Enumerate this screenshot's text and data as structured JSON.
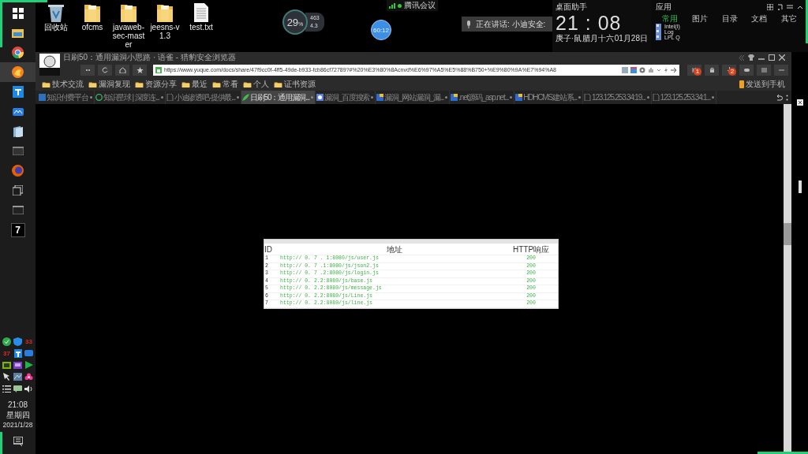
{
  "taskbar": {
    "tile_label": "7",
    "tray_counts": [
      "33",
      "37"
    ],
    "clock": {
      "time": "21:08",
      "weekday": "星期四",
      "date": "2021/1/28"
    }
  },
  "desktop_icons": [
    {
      "label": "回收站",
      "kind": "bin"
    },
    {
      "label": "ofcms",
      "kind": "folder"
    },
    {
      "label": "javaweb-sec-master",
      "kind": "folder"
    },
    {
      "label": "jeesns-v1.3",
      "kind": "folder"
    },
    {
      "label": "test.txt",
      "kind": "file"
    }
  ],
  "net_meter": {
    "percent": "29",
    "unit": "%",
    "upload": "463",
    "download": "4.3"
  },
  "meeting": {
    "title": "腾讯会议",
    "timer": "60:12",
    "speaking": "正在讲话: 小迪安全:"
  },
  "clock_widget": {
    "title": "桌面助手",
    "time": "21 : 08",
    "lunar_year": "庚子·鼠",
    "lunar_day": "腊月十六",
    "date": "01月28日"
  },
  "apps_panel": {
    "title": "应用",
    "tabs": [
      {
        "label": "常用",
        "selected": true
      },
      {
        "label": "图片",
        "selected": false
      },
      {
        "label": "目录",
        "selected": false
      },
      {
        "label": "文档",
        "selected": false
      },
      {
        "label": "其它",
        "selected": false
      }
    ],
    "items": [
      "Intel(I)",
      "Log",
      "LPL Q"
    ]
  },
  "browser": {
    "title": "日刷50：通用漏洞小思路 · 语雀 - 猎豹安全浏览器",
    "url": "https://www.yuque.com/docs/share/47f9cc0f-4ff5-49de-b933-fcb86cf72789?#%20%E3%80%8Acnvd%E6%97%A5%E5%88%B750+%E9%80%9A%E7%94%A8",
    "badges": [
      "1",
      "2"
    ],
    "bookmarks": [
      "技术交流",
      "漏洞复现",
      "资源分享",
      "最近",
      "常看",
      "个人",
      "证书资源"
    ],
    "send_to_phone": "发送到手机",
    "tabs": [
      {
        "label": "知识付费平台",
        "selected": false
      },
      {
        "label": "知识星球 | 深度连...",
        "selected": false
      },
      {
        "label": "小迪渗透吧-提供最...",
        "selected": false
      },
      {
        "label": "日刷50：通用漏洞...",
        "selected": true
      },
      {
        "label": "漏洞_百度搜索",
        "selected": false
      },
      {
        "label": "漏洞_网站漏洞_漏...",
        "selected": false
      },
      {
        "label": ".net源码_asp.net...",
        "selected": false
      },
      {
        "label": "HDHCMS建站系...",
        "selected": false
      },
      {
        "label": "123.125.253.34:19...",
        "selected": false
      },
      {
        "label": "123.125.253.34:1...",
        "selected": false
      }
    ]
  },
  "result_table": {
    "columns": [
      "ID",
      "地址",
      "HTTP响应"
    ],
    "rows": [
      [
        "1",
        "http:// 0. 7 . 1:8080/js/user.js",
        "200"
      ],
      [
        "2",
        "http:// 0. 7 .1:8080/js/json2.js",
        "200"
      ],
      [
        "3",
        "http:// 0. 7 .2:8080/js/login.js",
        "200"
      ],
      [
        "4",
        "http:// 0. 2.2:8080/js/base.js",
        "200"
      ],
      [
        "5",
        "http:// 0. 2.2:8080/js/message.js",
        "200"
      ],
      [
        "6",
        "http:// 0. 2.2:8080/js/Line.js",
        "200"
      ],
      [
        "7",
        "http:// 0. 2.2:8080/js/line.js",
        "200"
      ]
    ]
  }
}
